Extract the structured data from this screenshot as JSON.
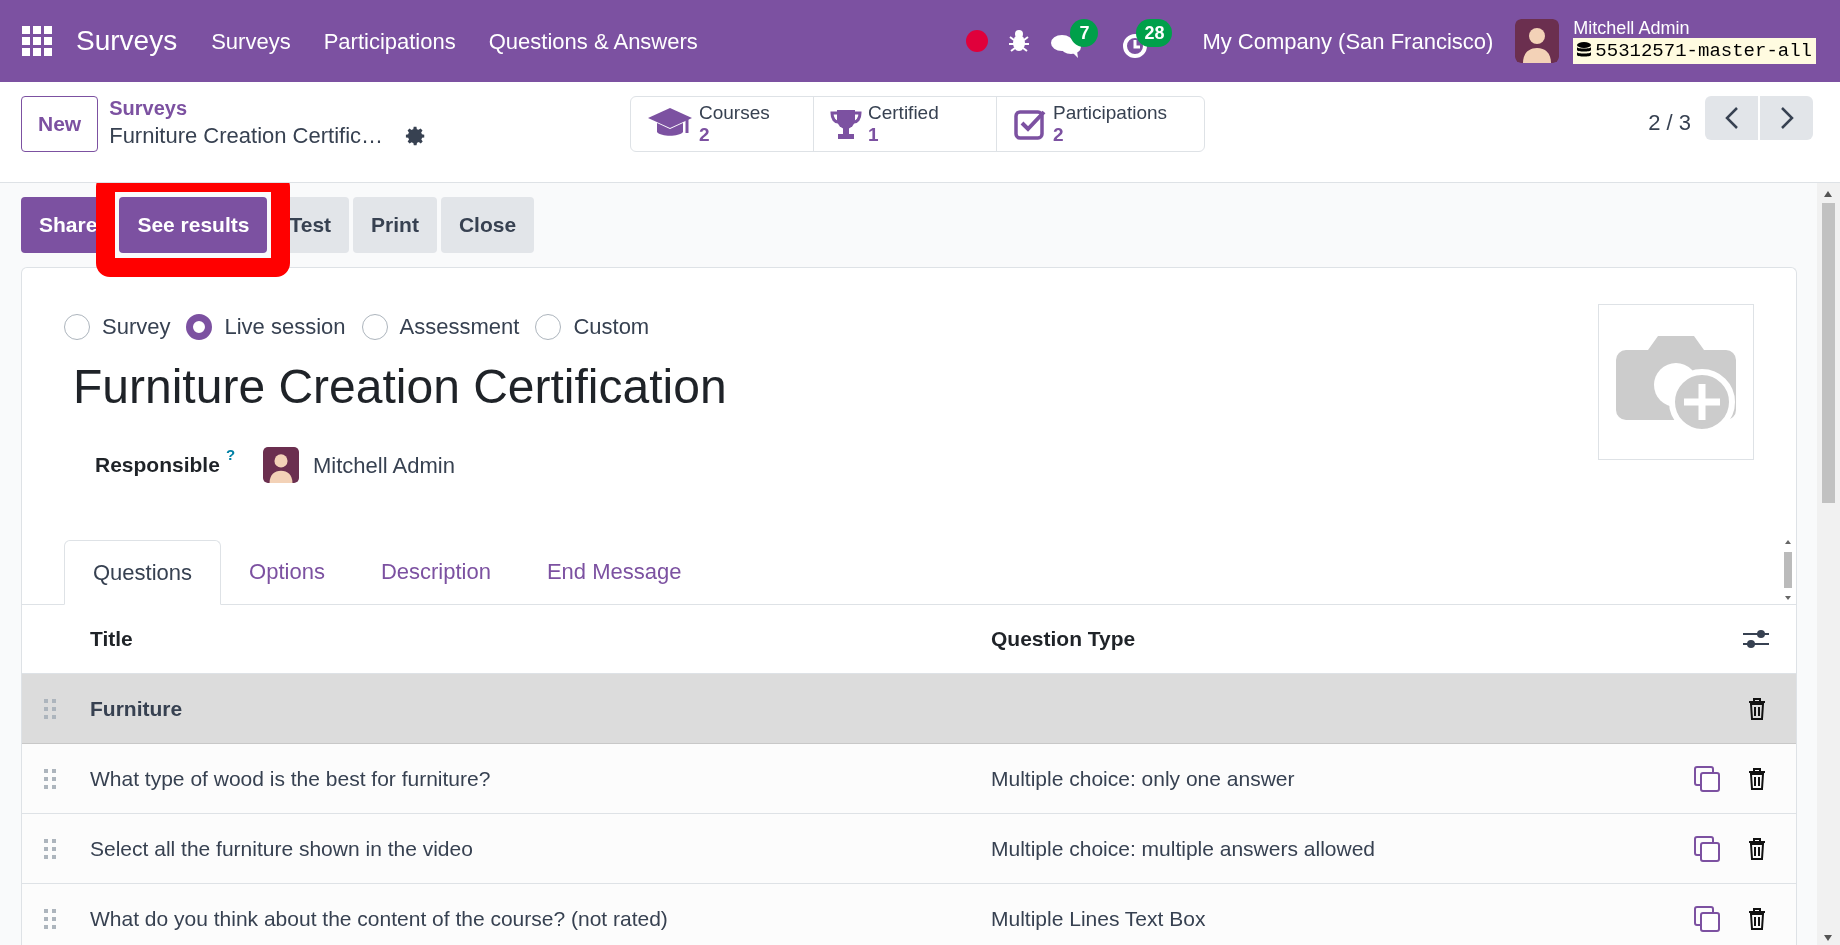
{
  "navbar": {
    "app_name": "Surveys",
    "menu": [
      "Surveys",
      "Participations",
      "Questions & Answers"
    ],
    "messages_count": "7",
    "activities_count": "28",
    "company": "My Company (San Francisco)",
    "user_name": "Mitchell Admin",
    "database": "55312571-master-all"
  },
  "control_panel": {
    "new_button": "New",
    "breadcrumb_parent": "Surveys",
    "breadcrumb_current": "Furniture Creation Certific…",
    "smart_buttons": [
      {
        "kind": "courses",
        "label": "Courses",
        "value": "2"
      },
      {
        "kind": "certified",
        "label": "Certified",
        "value": "1"
      },
      {
        "kind": "participations",
        "label": "Participations",
        "value": "2"
      }
    ],
    "pager": "2 / 3"
  },
  "actions": [
    {
      "label": "Share",
      "primary": true,
      "highlighted": false
    },
    {
      "label": "See results",
      "primary": true,
      "highlighted": true
    },
    {
      "label": "Test",
      "primary": false,
      "highlighted": false
    },
    {
      "label": "Print",
      "primary": false,
      "highlighted": false
    },
    {
      "label": "Close",
      "primary": false,
      "highlighted": false
    }
  ],
  "form": {
    "survey_types": [
      {
        "label": "Survey",
        "selected": false
      },
      {
        "label": "Live session",
        "selected": true
      },
      {
        "label": "Assessment",
        "selected": false
      },
      {
        "label": "Custom",
        "selected": false
      }
    ],
    "title": "Furniture Creation Certification",
    "responsible_label": "Responsible",
    "responsible_help": "?",
    "responsible_value": "Mitchell Admin",
    "tabs": [
      {
        "label": "Questions",
        "selected": true
      },
      {
        "label": "Options",
        "selected": false
      },
      {
        "label": "Description",
        "selected": false
      },
      {
        "label": "End Message",
        "selected": false
      }
    ]
  },
  "table": {
    "columns": [
      "Title",
      "Question Type"
    ],
    "rows": [
      {
        "kind": "section",
        "title": "Furniture"
      },
      {
        "kind": "question",
        "title": "What type of wood is the best for furniture?",
        "question_type": "Multiple choice: only one answer"
      },
      {
        "kind": "question",
        "title": "Select all the furniture shown in the video",
        "question_type": "Multiple choice: multiple answers allowed"
      },
      {
        "kind": "question",
        "title": "What do you think about the content of the course? (not rated)",
        "question_type": "Multiple Lines Text Box"
      }
    ]
  }
}
